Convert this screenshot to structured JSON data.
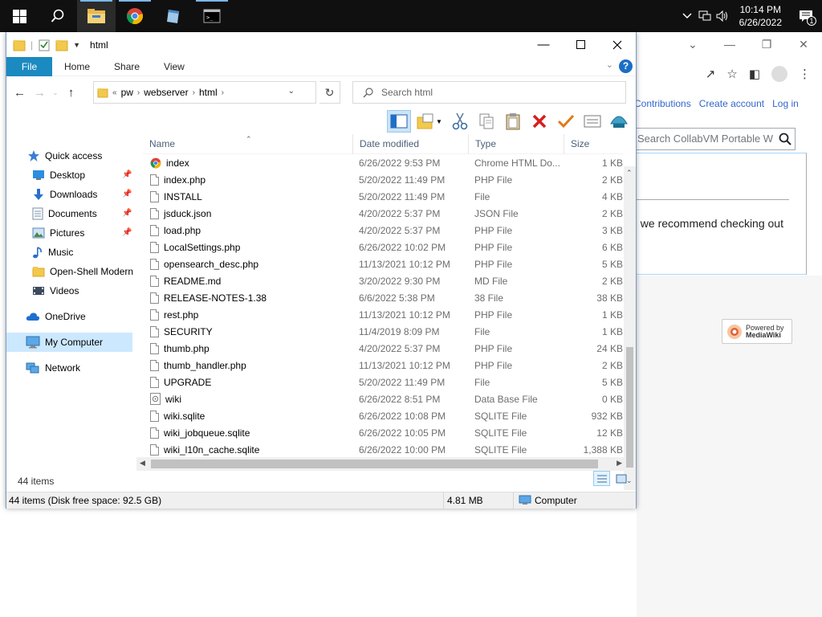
{
  "taskbar": {
    "clock_time": "10:14 PM",
    "clock_date": "6/26/2022",
    "notification_count": "1"
  },
  "background_browser": {
    "links": [
      "Contributions",
      "Create account",
      "Log in"
    ],
    "search_placeholder": "Search CollabVM Portable W",
    "content_text": ", we recommend checking out",
    "powered_line1": "Powered by",
    "powered_line2": "MediaWiki"
  },
  "explorer": {
    "title": "html",
    "ribbon_tabs": [
      "File",
      "Home",
      "Share",
      "View"
    ],
    "address": {
      "overflow": "«",
      "segments": [
        "pw",
        "webserver",
        "html"
      ]
    },
    "search_placeholder": "Search html",
    "nav_pane": {
      "quick_access": "Quick access",
      "pinned": [
        "Desktop",
        "Downloads",
        "Documents",
        "Pictures"
      ],
      "other": [
        "Music",
        "Open-Shell Modern",
        "Videos"
      ],
      "onedrive": "OneDrive",
      "my_computer": "My Computer",
      "network": "Network"
    },
    "columns": [
      "Name",
      "Date modified",
      "Type",
      "Size"
    ],
    "files": [
      {
        "name": "index",
        "date": "6/26/2022 9:53 PM",
        "type": "Chrome HTML Do...",
        "size": "1 KB",
        "icon": "chrome"
      },
      {
        "name": "index.php",
        "date": "5/20/2022 11:49 PM",
        "type": "PHP File",
        "size": "2 KB",
        "icon": "doc"
      },
      {
        "name": "INSTALL",
        "date": "5/20/2022 11:49 PM",
        "type": "File",
        "size": "4 KB",
        "icon": "doc"
      },
      {
        "name": "jsduck.json",
        "date": "4/20/2022 5:37 PM",
        "type": "JSON File",
        "size": "2 KB",
        "icon": "doc"
      },
      {
        "name": "load.php",
        "date": "4/20/2022 5:37 PM",
        "type": "PHP File",
        "size": "3 KB",
        "icon": "doc"
      },
      {
        "name": "LocalSettings.php",
        "date": "6/26/2022 10:02 PM",
        "type": "PHP File",
        "size": "6 KB",
        "icon": "doc"
      },
      {
        "name": "opensearch_desc.php",
        "date": "11/13/2021 10:12 PM",
        "type": "PHP File",
        "size": "5 KB",
        "icon": "doc"
      },
      {
        "name": "README.md",
        "date": "3/20/2022 9:30 PM",
        "type": "MD File",
        "size": "2 KB",
        "icon": "doc"
      },
      {
        "name": "RELEASE-NOTES-1.38",
        "date": "6/6/2022 5:38 PM",
        "type": "38 File",
        "size": "38 KB",
        "icon": "doc"
      },
      {
        "name": "rest.php",
        "date": "11/13/2021 10:12 PM",
        "type": "PHP File",
        "size": "1 KB",
        "icon": "doc"
      },
      {
        "name": "SECURITY",
        "date": "11/4/2019 8:09 PM",
        "type": "File",
        "size": "1 KB",
        "icon": "doc"
      },
      {
        "name": "thumb.php",
        "date": "4/20/2022 5:37 PM",
        "type": "PHP File",
        "size": "24 KB",
        "icon": "doc"
      },
      {
        "name": "thumb_handler.php",
        "date": "11/13/2021 10:12 PM",
        "type": "PHP File",
        "size": "2 KB",
        "icon": "doc"
      },
      {
        "name": "UPGRADE",
        "date": "5/20/2022 11:49 PM",
        "type": "File",
        "size": "5 KB",
        "icon": "doc"
      },
      {
        "name": "wiki",
        "date": "6/26/2022 8:51 PM",
        "type": "Data Base File",
        "size": "0 KB",
        "icon": "db"
      },
      {
        "name": "wiki.sqlite",
        "date": "6/26/2022 10:08 PM",
        "type": "SQLITE File",
        "size": "932 KB",
        "icon": "doc"
      },
      {
        "name": "wiki_jobqueue.sqlite",
        "date": "6/26/2022 10:05 PM",
        "type": "SQLITE File",
        "size": "12 KB",
        "icon": "doc"
      },
      {
        "name": "wiki_l10n_cache.sqlite",
        "date": "6/26/2022 10:00 PM",
        "type": "SQLITE File",
        "size": "1,388 KB",
        "icon": "doc"
      }
    ],
    "item_count": "44 items",
    "status": {
      "items_free": "44 items (Disk free space: 92.5 GB)",
      "size": "4.81 MB",
      "location": "Computer"
    }
  }
}
